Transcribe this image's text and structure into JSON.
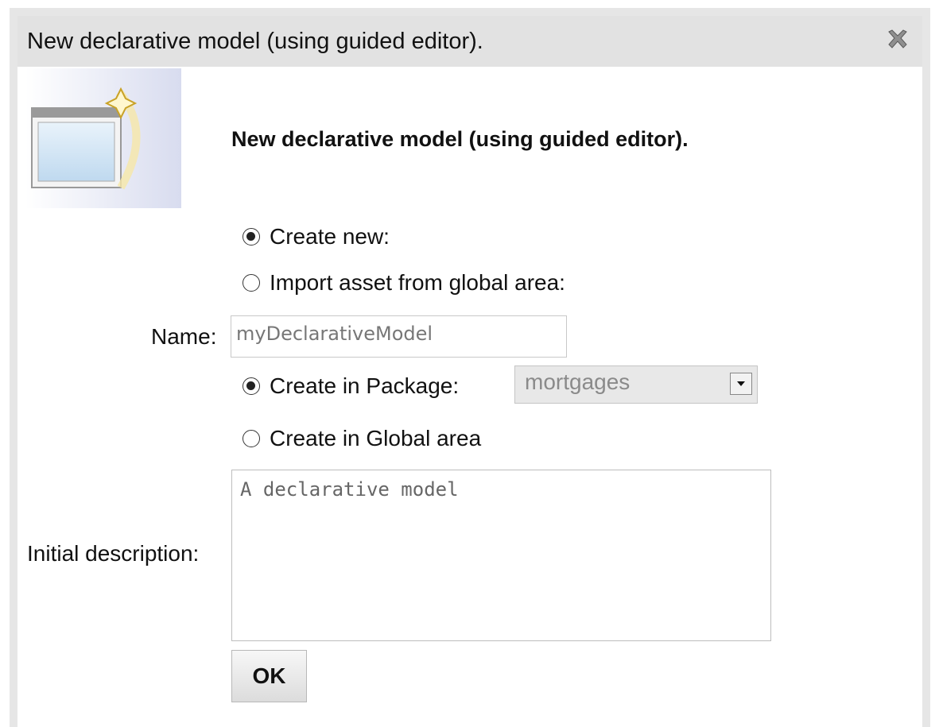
{
  "dialog": {
    "title": "New declarative model (using guided editor).",
    "heading": "New declarative model (using guided editor).",
    "close_icon": "close-icon"
  },
  "source": {
    "create_new_label": "Create new:",
    "import_label": "Import asset from global area:",
    "selected": "create_new"
  },
  "name": {
    "label": "Name:",
    "value": "myDeclarativeModel"
  },
  "location": {
    "package_label": "Create in Package:",
    "package_value": "mortgages",
    "global_label": "Create in Global area",
    "selected": "package"
  },
  "description": {
    "label": "Initial description:",
    "value": "A declarative model"
  },
  "ok_label": "OK",
  "colors": {
    "titlebar": "#e2e2e2",
    "border": "#e6e6e6"
  }
}
